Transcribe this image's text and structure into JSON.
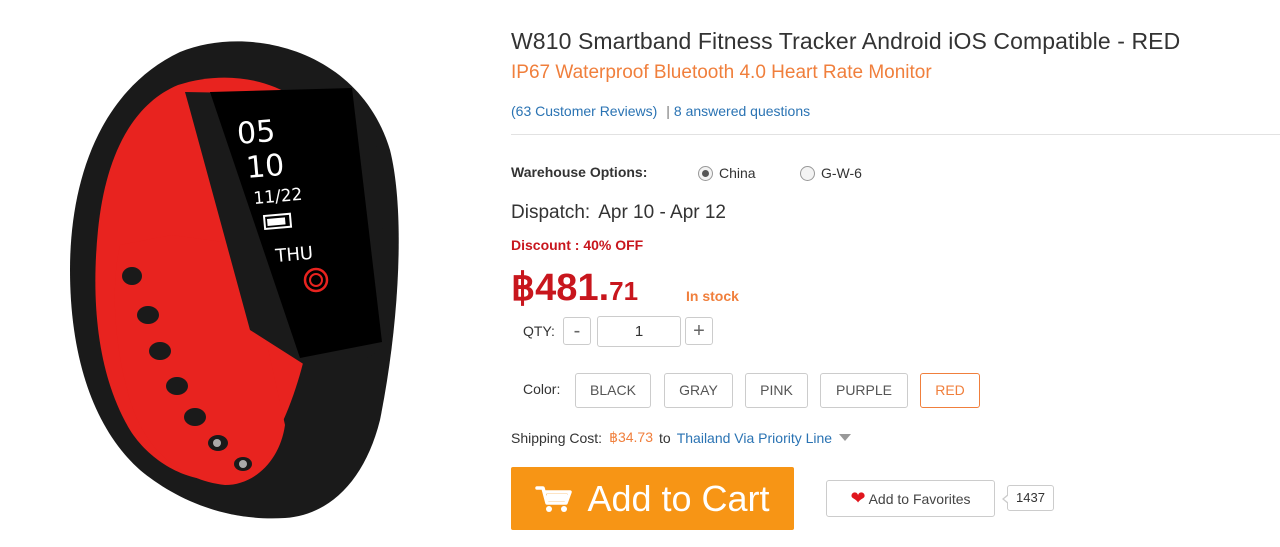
{
  "product": {
    "title": "W810 Smartband Fitness Tracker Android iOS Compatible  -  RED",
    "subtitle": "IP67 Waterproof Bluetooth 4.0 Heart Rate Monitor",
    "reviews_link": "(63 Customer Reviews)",
    "reviews_separator": "|",
    "questions_link": "8 answered questions"
  },
  "image": {
    "watch_time_hour": "05",
    "watch_time_minute": "10",
    "watch_date": "11/22",
    "watch_day": "THU",
    "colors": {
      "strap_outer": "#1a1a1a",
      "strap_inner": "#e8231f",
      "screen": "#000000"
    }
  },
  "warehouse": {
    "label": "Warehouse Options:",
    "options": [
      {
        "label": "China",
        "selected": true
      },
      {
        "label": "G-W-6",
        "selected": false
      }
    ]
  },
  "dispatch": {
    "label": "Dispatch:",
    "value": "Apr 10 - Apr 12"
  },
  "discount": {
    "text": "Discount : 40% OFF"
  },
  "price": {
    "main": "฿481.",
    "cents": "71",
    "stock": "In stock"
  },
  "quantity": {
    "label": "QTY:",
    "minus": "-",
    "plus": "+",
    "value": "1"
  },
  "colors": {
    "label": "Color:",
    "options": [
      "BLACK",
      "GRAY",
      "PINK",
      "PURPLE",
      "RED"
    ],
    "selected": "RED"
  },
  "shipping": {
    "label": "Shipping Cost:",
    "cost": "฿34.73",
    "to": "to",
    "destination": "Thailand Via Priority Line"
  },
  "cart": {
    "label": "Add to Cart"
  },
  "favorites": {
    "label": "Add to Favorites",
    "count": "1437"
  },
  "theme": {
    "accent": "#f79515",
    "price_red": "#c8161d",
    "link_blue": "#2a73b3",
    "orange_text": "#f07f3c"
  }
}
